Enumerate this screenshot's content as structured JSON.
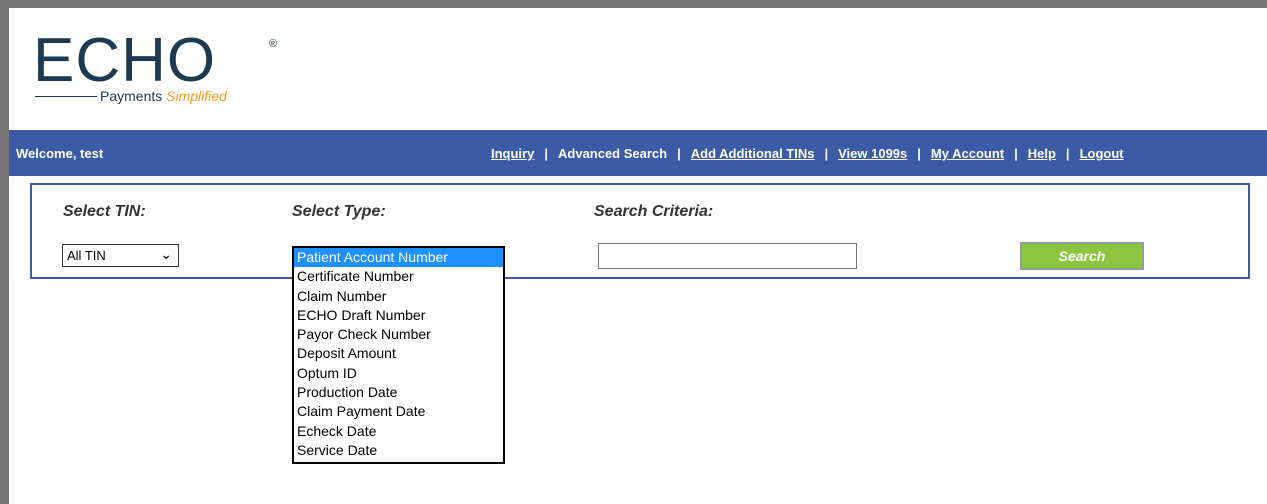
{
  "logo": {
    "brand": "ECHO",
    "registered": "®",
    "tagline_main": "Payments ",
    "tagline_accent": "Simplified"
  },
  "header": {
    "welcome": "Welcome, test",
    "links": [
      {
        "label": "Inquiry",
        "underlined": true
      },
      {
        "label": "Advanced Search",
        "underlined": false
      },
      {
        "label": "Add Additional TINs",
        "underlined": true
      },
      {
        "label": "View 1099s",
        "underlined": true
      },
      {
        "label": "My Account",
        "underlined": true
      },
      {
        "label": "Help",
        "underlined": true
      },
      {
        "label": "Logout",
        "underlined": true
      }
    ],
    "separator": "|"
  },
  "search": {
    "tin_label": "Select TIN:",
    "tin_value": "All TIN",
    "type_label": "Select Type:",
    "type_options": [
      "Patient Account Number",
      "Certificate Number",
      "Claim Number",
      "ECHO Draft Number",
      "Payor Check Number",
      "Deposit Amount",
      "Optum ID",
      "Production Date",
      "Claim Payment Date",
      "Echeck Date",
      "Service Date"
    ],
    "type_selected_index": 0,
    "criteria_label": "Search Criteria:",
    "criteria_value": "",
    "search_button": "Search"
  },
  "colors": {
    "navbar": "#3b5ba6",
    "search_button": "#8cc63f",
    "selected_option": "#1e90ff",
    "brand_accent": "#f19a22"
  }
}
